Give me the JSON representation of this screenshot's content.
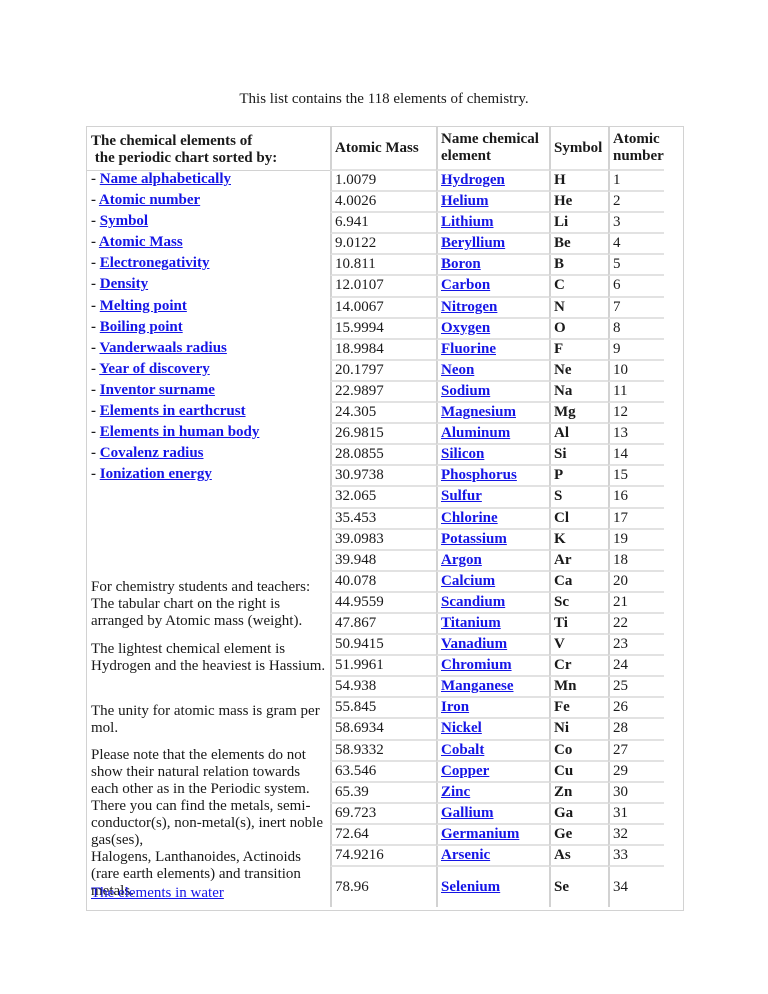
{
  "intro": "This list contains the 118 elements of chemistry.",
  "sidebar": {
    "heading_line1": "The chemical elements of",
    "heading_line2": " the periodic chart sorted by:",
    "sort_links": [
      "Name alphabetically",
      "Atomic number",
      "Symbol",
      "Atomic Mass",
      "Electronegativity",
      "Density",
      "Melting point",
      "Boiling point",
      "Vanderwaals radius",
      "Year of discovery",
      "Inventor surname",
      "Elements in earthcrust",
      "Elements in human body",
      "Covalenz radius",
      "Ionization energy"
    ],
    "bullet": "- ",
    "para1": "For chemistry students and teachers: The tabular chart on the right is arranged by Atomic mass (weight).",
    "para2": "The lightest chemical element is Hydrogen and the heaviest is Hassium.",
    "para3": "The unity for atomic mass is gram per mol.",
    "para4a": "Please note that the elements do not show their natural relation towards each other as in the Periodic system. There you can find the metals, semi-conductor(s), non-metal(s), inert noble gas(ses),",
    "para4b": "Halogens,  Lanthanoides, Actinoids (rare earth elements) and transition metals.",
    "water_link": "The elements in water"
  },
  "table": {
    "headers": {
      "mass": "Atomic Mass",
      "name": "Name chemical element",
      "symbol": "Symbol",
      "number": "Atomic number"
    },
    "rows": [
      {
        "mass": "1.0079",
        "name": "Hydrogen",
        "symbol": "H",
        "number": "1"
      },
      {
        "mass": "4.0026",
        "name": "Helium",
        "symbol": "He",
        "number": "2"
      },
      {
        "mass": "6.941",
        "name": "Lithium",
        "symbol": "Li",
        "number": "3"
      },
      {
        "mass": "9.0122",
        "name": "Beryllium",
        "symbol": "Be",
        "number": "4"
      },
      {
        "mass": "10.811",
        "name": "Boron",
        "symbol": "B",
        "number": "5"
      },
      {
        "mass": "12.0107",
        "name": "Carbon",
        "symbol": "C",
        "number": "6"
      },
      {
        "mass": "14.0067",
        "name": "Nitrogen",
        "symbol": "N",
        "number": "7"
      },
      {
        "mass": "15.9994",
        "name": "Oxygen",
        "symbol": "O",
        "number": "8"
      },
      {
        "mass": "18.9984",
        "name": "Fluorine",
        "symbol": "F",
        "number": "9"
      },
      {
        "mass": "20.1797",
        "name": "Neon",
        "symbol": "Ne",
        "number": "10"
      },
      {
        "mass": "22.9897",
        "name": "Sodium",
        "symbol": "Na",
        "number": "11"
      },
      {
        "mass": "24.305",
        "name": "Magnesium",
        "symbol": "Mg",
        "number": "12"
      },
      {
        "mass": "26.9815",
        "name": "Aluminum",
        "symbol": "Al",
        "number": "13"
      },
      {
        "mass": "28.0855",
        "name": "Silicon",
        "symbol": "Si",
        "number": "14"
      },
      {
        "mass": "30.9738",
        "name": "Phosphorus",
        "symbol": "P",
        "number": "15"
      },
      {
        "mass": "32.065",
        "name": "Sulfur",
        "symbol": "S",
        "number": "16"
      },
      {
        "mass": "35.453",
        "name": "Chlorine",
        "symbol": "Cl",
        "number": "17"
      },
      {
        "mass": "39.0983",
        "name": "Potassium",
        "symbol": "K",
        "number": "19"
      },
      {
        "mass": "39.948",
        "name": "Argon",
        "symbol": "Ar",
        "number": "18"
      },
      {
        "mass": "40.078",
        "name": "Calcium",
        "symbol": "Ca",
        "number": "20"
      },
      {
        "mass": "44.9559",
        "name": "Scandium",
        "symbol": "Sc",
        "number": "21"
      },
      {
        "mass": "47.867",
        "name": "Titanium",
        "symbol": "Ti",
        "number": "22"
      },
      {
        "mass": "50.9415",
        "name": "Vanadium",
        "symbol": "V",
        "number": "23"
      },
      {
        "mass": "51.9961",
        "name": "Chromium",
        "symbol": "Cr",
        "number": "24"
      },
      {
        "mass": "54.938",
        "name": "Manganese",
        "symbol": "Mn",
        "number": "25"
      },
      {
        "mass": "55.845",
        "name": "Iron",
        "symbol": "Fe",
        "number": "26"
      },
      {
        "mass": "58.6934",
        "name": "Nickel",
        "symbol": "Ni",
        "number": "28"
      },
      {
        "mass": "58.9332",
        "name": "Cobalt",
        "symbol": "Co",
        "number": "27"
      },
      {
        "mass": "63.546",
        "name": "Copper",
        "symbol": "Cu",
        "number": "29"
      },
      {
        "mass": "65.39",
        "name": "Zinc",
        "symbol": "Zn",
        "number": "30"
      },
      {
        "mass": "69.723",
        "name": "Gallium",
        "symbol": "Ga",
        "number": "31"
      },
      {
        "mass": "72.64",
        "name": "Germanium",
        "symbol": "Ge",
        "number": "32"
      },
      {
        "mass": "74.9216",
        "name": "Arsenic",
        "symbol": "As",
        "number": "33"
      },
      {
        "mass": "78.96",
        "name": "Selenium",
        "symbol": "Se",
        "number": "34"
      }
    ]
  }
}
